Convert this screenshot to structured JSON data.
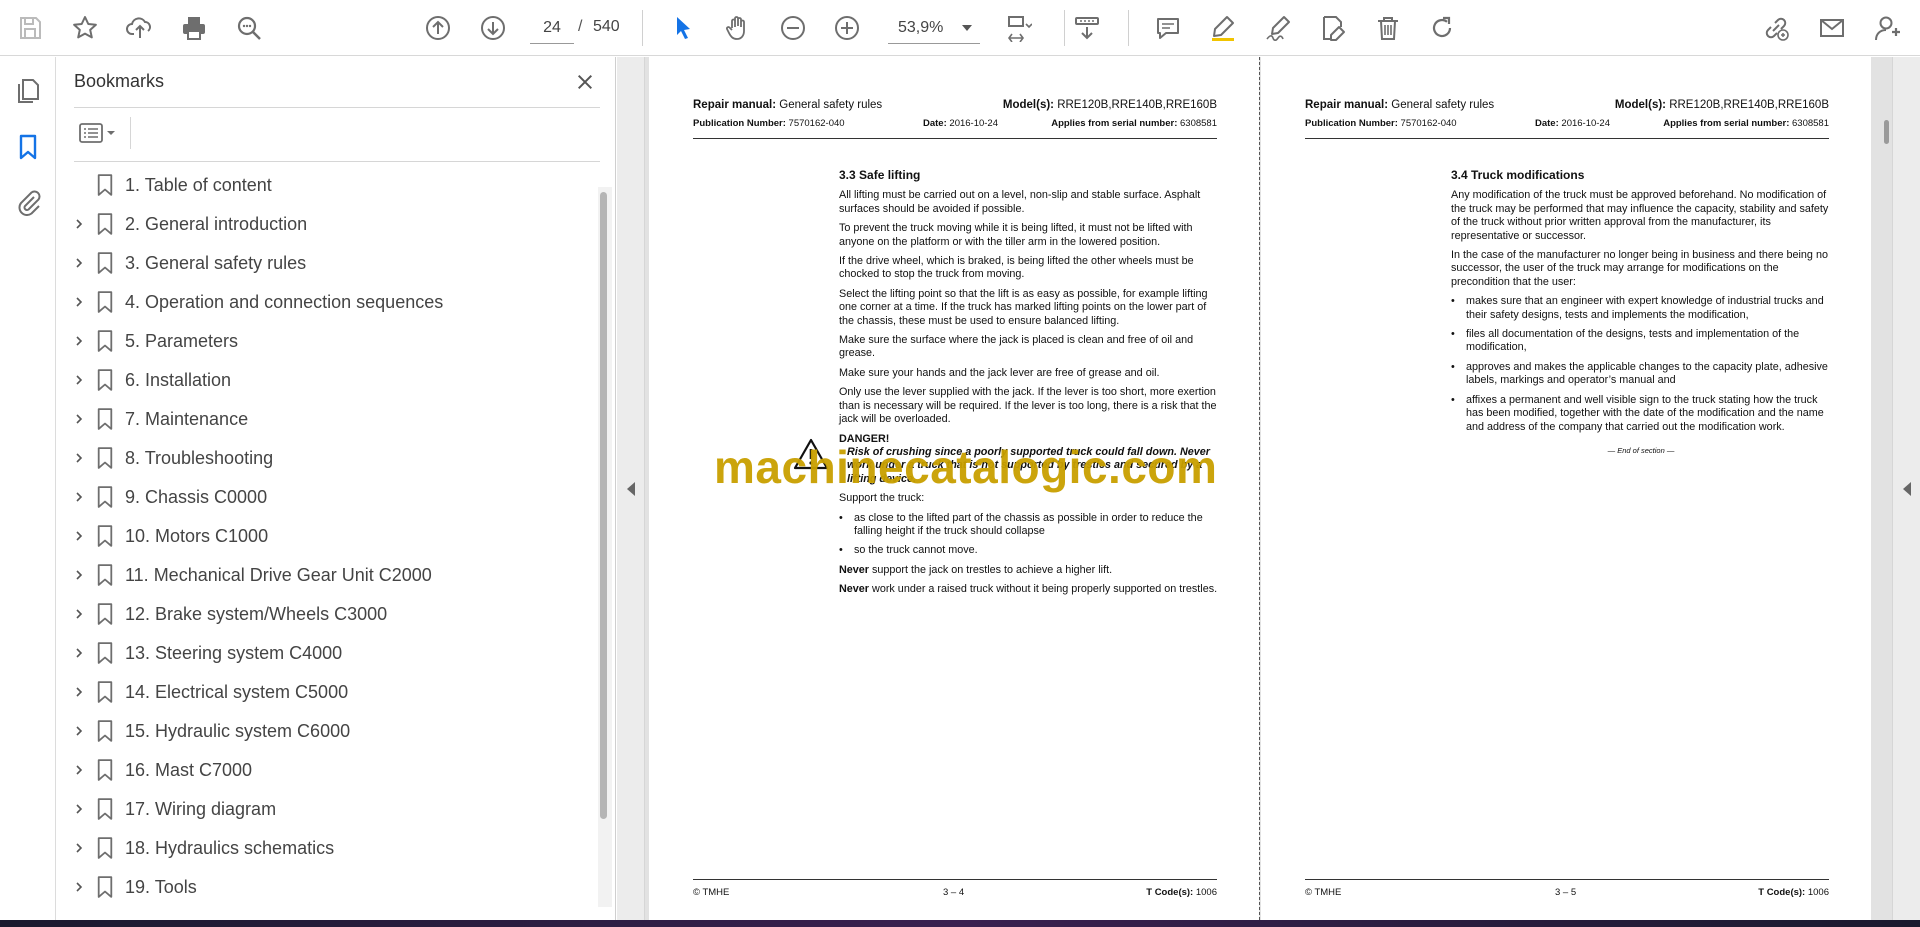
{
  "toolbar": {
    "icons": [
      "save-icon",
      "star-icon",
      "upload-icon",
      "print-icon",
      "zoom-search-icon",
      "page-up-icon",
      "page-down-icon",
      "select-arrow-icon",
      "hand-icon",
      "zoom-out-icon",
      "zoom-in-icon",
      "fit-page-icon",
      "scroll-mode-icon",
      "comment-icon",
      "highlight-icon",
      "sign-icon",
      "edit-icon",
      "delete-icon",
      "rotate-icon",
      "share-link-icon",
      "email-icon",
      "account-icon"
    ],
    "current_page": "24",
    "page_separator": "/",
    "total_pages": "540",
    "zoom": "53,9%"
  },
  "bookmarks": {
    "title": "Bookmarks",
    "items": [
      {
        "label": "1. Table of content",
        "expandable": false
      },
      {
        "label": "2. General introduction",
        "expandable": true
      },
      {
        "label": "3. General safety rules",
        "expandable": true
      },
      {
        "label": "4. Operation and connection sequences",
        "expandable": true
      },
      {
        "label": "5. Parameters",
        "expandable": true
      },
      {
        "label": "6. Installation",
        "expandable": true
      },
      {
        "label": "7. Maintenance",
        "expandable": true
      },
      {
        "label": "8. Troubleshooting",
        "expandable": true
      },
      {
        "label": "9. Chassis C0000",
        "expandable": true
      },
      {
        "label": "10. Motors C1000",
        "expandable": true
      },
      {
        "label": "11. Mechanical Drive Gear Unit C2000",
        "expandable": true
      },
      {
        "label": "12. Brake system/Wheels C3000",
        "expandable": true
      },
      {
        "label": "13. Steering system C4000",
        "expandable": true
      },
      {
        "label": "14. Electrical system C5000",
        "expandable": true
      },
      {
        "label": "15. Hydraulic system C6000",
        "expandable": true
      },
      {
        "label": "16. Mast C7000",
        "expandable": true
      },
      {
        "label": "17. Wiring diagram",
        "expandable": true
      },
      {
        "label": "18. Hydraulics schematics",
        "expandable": true
      },
      {
        "label": "19. Tools",
        "expandable": true
      }
    ]
  },
  "page_left": {
    "header": {
      "manual_label": "Repair manual:",
      "manual_value": " General safety rules",
      "model_label": "Model(s):",
      "model_value": " RRE120B,RRE140B,RRE160B",
      "pub_label": "Publication Number:",
      "pub_value": " 7570162-040",
      "date_label": "Date:",
      "date_value": " 2016-10-24",
      "serial_label": "Applies from serial number:",
      "serial_value": " 6308581"
    },
    "section_title": "3.3 Safe lifting",
    "paragraphs_top": [
      "All lifting must be carried out on a level, non-slip and stable surface. Asphalt surfaces should be avoided if possible.",
      "To prevent the truck moving while it is being lifted, it must not be lifted with anyone on the platform or with the tiller arm in the lowered position.",
      "If the drive wheel, which is braked, is being lifted the other wheels must be chocked to stop the truck from moving.",
      "Select the lifting point so that the lift is as easy as possible, for example lifting one corner at a time. If the truck has marked lifting points on the lower part of the chassis, these must be used to ensure balanced lifting.",
      "Make sure the surface where the jack is placed is clean and free of oil and grease.",
      "Make sure your hands and the jack lever are free of grease and oil.",
      "Only use the lever supplied with the jack. If the lever is too short, more exertion than is necessary will be required. If the lever is too long, there is a risk that the jack will be overloaded."
    ],
    "danger_head": "DANGER!",
    "danger_text": "Risk of crushing since a poorly supported truck could fall down. Never work under a truck that is not supported by trestles and secured by a lifting device.",
    "support_intro": "Support the truck:",
    "bullets": [
      "as close to the lifted part of the chassis as possible in order to reduce the falling height if the truck should collapse",
      "so the truck cannot move."
    ],
    "never1_bold": "Never",
    "never1_rest": " support the jack on trestles to achieve a higher lift.",
    "never2_bold": "Never",
    "never2_rest": " work under a raised truck without it being properly supported on trestles.",
    "footer": {
      "left": "© TMHE",
      "center": "3 – 4",
      "right_label": "T Code(s):",
      "right_value": " 1006"
    }
  },
  "page_right": {
    "header": {
      "manual_label": "Repair manual:",
      "manual_value": " General safety rules",
      "model_label": "Model(s):",
      "model_value": " RRE120B,RRE140B,RRE160B",
      "pub_label": "Publication Number:",
      "pub_value": " 7570162-040",
      "date_label": "Date:",
      "date_value": " 2016-10-24",
      "serial_label": "Applies from serial number:",
      "serial_value": " 6308581"
    },
    "section_title": "3.4 Truck modifications",
    "paragraphs": [
      "Any modification of the truck must be approved beforehand. No modification of the truck may be performed that may influence the capacity, stability and safety of the truck without prior written approval from the manufacturer, its representative or successor.",
      "In the case of the manufacturer no longer being in business and there being no successor, the user of the truck may arrange for modifications on the precondition that the user:"
    ],
    "bullets": [
      "makes sure that an engineer with expert knowledge of industrial trucks and their safety designs, tests and implements the modification,",
      "files all documentation of the designs, tests and implementation of the modification,",
      "approves and makes the applicable changes to the capacity plate, adhesive labels, markings and operator’s manual and",
      "affixes a permanent and well visible sign to the truck stating how the truck has been modified, together with the date of the modification and the name and address of the company that carried out the modification work."
    ],
    "end_note": "— End of section —",
    "footer": {
      "left": "© TMHE",
      "center": "3 – 5",
      "right_label": "T Code(s):",
      "right_value": " 1006"
    }
  },
  "watermark": "machinecatalogic.com",
  "colors": {
    "accent": "#1473e6",
    "watermark": "#c9a000",
    "icon": "#6e6e6e"
  }
}
